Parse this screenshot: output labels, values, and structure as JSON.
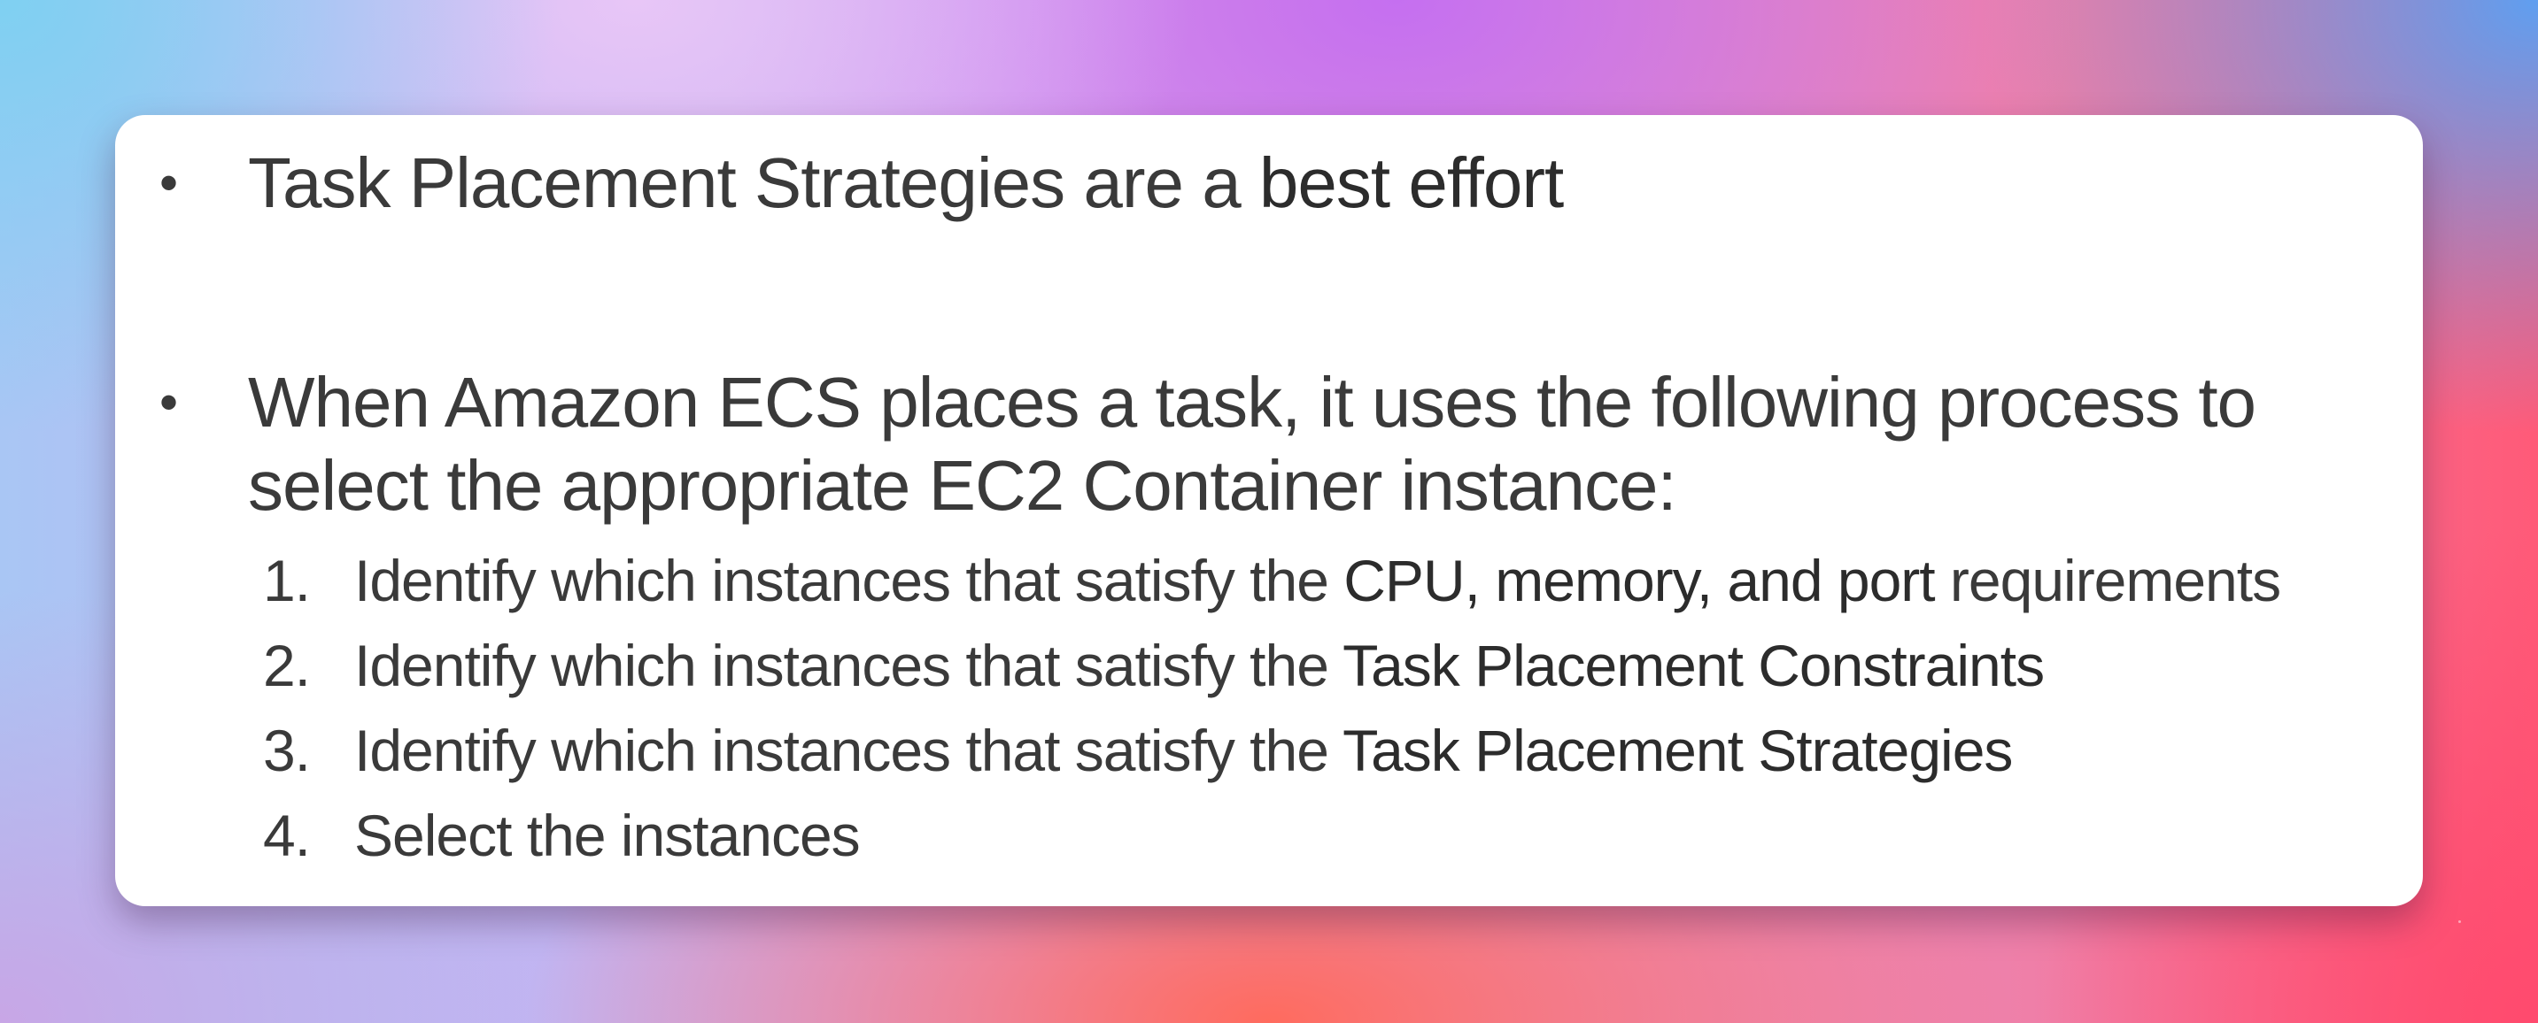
{
  "colors": {
    "card_background": "#ffffff",
    "text": "#3a3a3a"
  },
  "bullets": [
    {
      "marker": "•",
      "text": "Task Placement Strategies are a ",
      "emphasis": "best effort"
    },
    {
      "marker": "•",
      "text": "When Amazon ECS places a task, it uses the following process to select the appropriate EC2 Container instance:"
    }
  ],
  "steps": [
    {
      "number": "1.",
      "text": "Identify which instances that satisfy the ",
      "emphasis": "CPU, memory, and port",
      "suffix": " requirements"
    },
    {
      "number": "2.",
      "text": "Identify which instances that satisfy the ",
      "emphasis": "Task Placement Constraints",
      "suffix": ""
    },
    {
      "number": "3.",
      "text": "Identify which instances that satisfy the ",
      "emphasis": "Task Placement Strategies",
      "suffix": ""
    },
    {
      "number": "4.",
      "text": "Select the instances",
      "emphasis": "",
      "suffix": ""
    }
  ]
}
